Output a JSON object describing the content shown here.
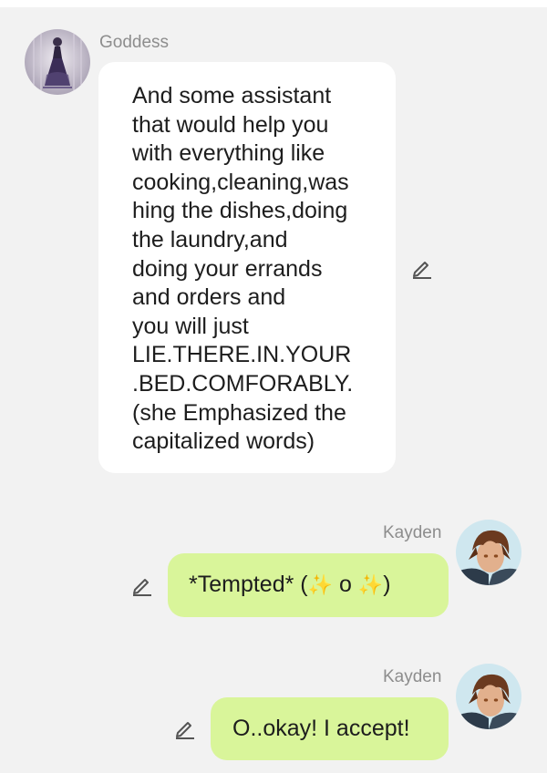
{
  "chat": {
    "messages": [
      {
        "sender": "Goddess",
        "direction": "incoming",
        "text": "And some assistant\nthat would help you\nwith everything like\ncooking,cleaning,was\nhing the dishes,doing\nthe laundry,and\ndoing your errands\nand orders and\nyou will just\nLIE.THERE.IN.YOUR\n.BED.COMFORABLY.\n(she Emphasized the\ncapitalized words)",
        "avatar_icon": "gothic-dress-avatar"
      },
      {
        "sender": "Kayden",
        "direction": "outgoing",
        "text_start": "*Tempted* (",
        "sparkle_left": "✨",
        "text_mid": " o ",
        "sparkle_right": "✨",
        "text_end": ")",
        "avatar_icon": "brown-haired-man-avatar"
      },
      {
        "sender": "Kayden",
        "direction": "outgoing",
        "text": "O..okay! I accept!",
        "avatar_icon": "brown-haired-man-avatar"
      }
    ]
  },
  "colors": {
    "background": "#f2f2f2",
    "incoming_bubble": "#ffffff",
    "outgoing_bubble": "#d9f59a",
    "sender_name": "#8d8d8d",
    "text": "#1d1d1d",
    "icon": "#555555"
  },
  "icons": {
    "edit": "pencil-icon"
  }
}
